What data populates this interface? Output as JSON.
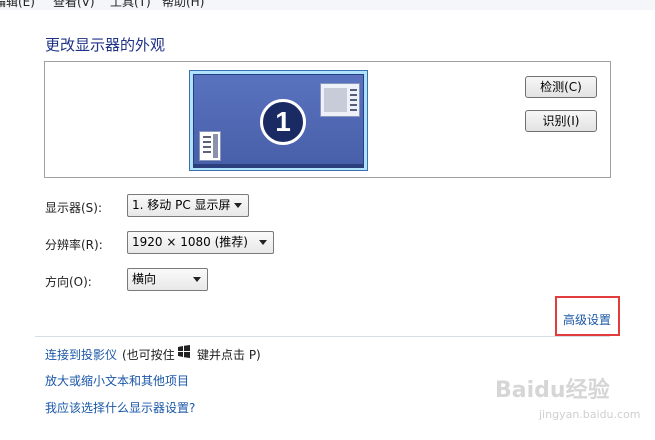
{
  "menubar": {
    "items": [
      "编辑(E)",
      "查看(V)",
      "工具(T)",
      "帮助(H)"
    ]
  },
  "page": {
    "title": "更改显示器的外观"
  },
  "preview": {
    "monitor_number": "1",
    "detect_label": "检测(C)",
    "identify_label": "识别(I)"
  },
  "settings": {
    "display_label": "显示器(S):",
    "display_value": "1. 移动 PC 显示屏",
    "resolution_label": "分辨率(R):",
    "resolution_value": "1920 × 1080 (推荐)",
    "orientation_label": "方向(O):",
    "orientation_value": "横向"
  },
  "advanced": {
    "link_label": "高级设置",
    "highlight_color": "#e23c3c"
  },
  "links": {
    "projector_link": "连接到投影仪",
    "projector_hint_prefix": "(也可按住",
    "projector_hint_suffix": "键并点击 P)",
    "text_size_link": "放大或缩小文本和其他项目",
    "which_settings_link": "我应该选择什么显示器设置?"
  },
  "watermark": {
    "main": "Baidu经验",
    "sub": "jingyan.baidu.com"
  },
  "colors": {
    "link": "#1a57a8",
    "title": "#1e3287",
    "monitor_screen": "#4c64ae"
  },
  "icons": [
    "windows-logo-icon"
  ]
}
